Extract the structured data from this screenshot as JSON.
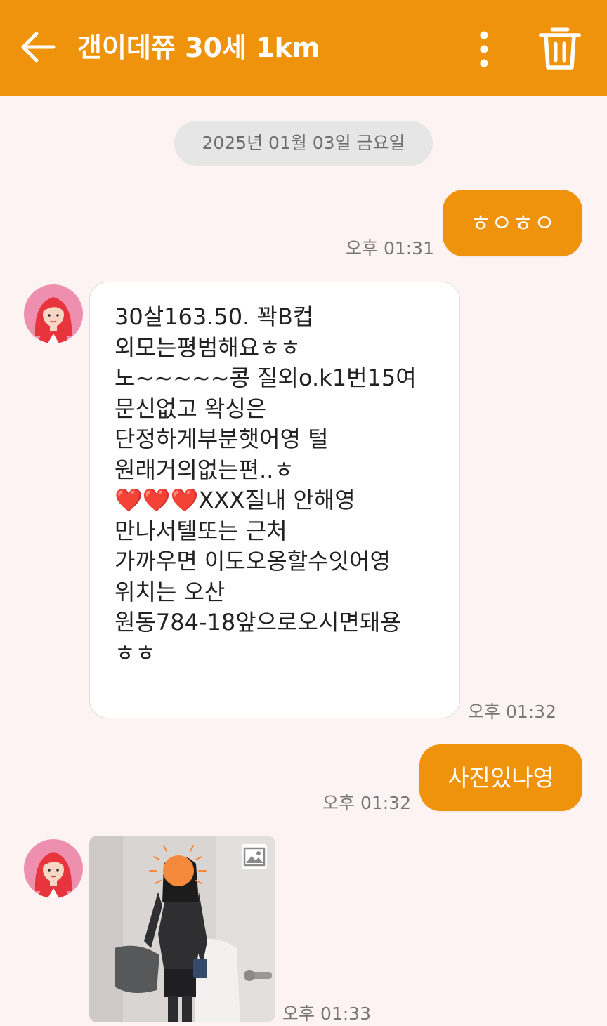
{
  "header": {
    "back_icon": "arrow-left-icon",
    "title": "갠이데쮸 30세 1km",
    "more_icon": "more-vertical-icon",
    "delete_icon": "trash-icon",
    "background_color": "#ef920c"
  },
  "date_separator": "2025년 01월 03일 금요일",
  "messages": [
    {
      "direction": "outgoing",
      "text": "ㅎㅇㅎㅇ",
      "time": "오후 01:31"
    },
    {
      "direction": "incoming",
      "avatar_icon": "female-avatar-icon",
      "text": "30살163.50. 꽉B컵\n외모는평범해요ㅎㅎ\n노~~~~~콩 질외o.k1번15여\n문신없고 왁싱은\n단정하게부분햇어영 털\n원래거의없는편..ㅎ\n❤️❤️❤️XXX질내 안해영\n만나서텔또는 근처\n가까우면 이도오옹할수잇어영\n위치는 오산\n원동784-18앞으로오시면돼용\nㅎㅎ",
      "time": "오후 01:32"
    },
    {
      "direction": "outgoing",
      "text": "사진있나영",
      "time": "오후 01:32"
    },
    {
      "direction": "incoming",
      "avatar_icon": "female-avatar-icon",
      "type": "photo",
      "photo_badge_icon": "image-icon",
      "time": "오후 01:33"
    }
  ],
  "colors": {
    "accent": "#ef920c",
    "background": "#fdf3f3",
    "date_pill": "#e6e6e6"
  }
}
